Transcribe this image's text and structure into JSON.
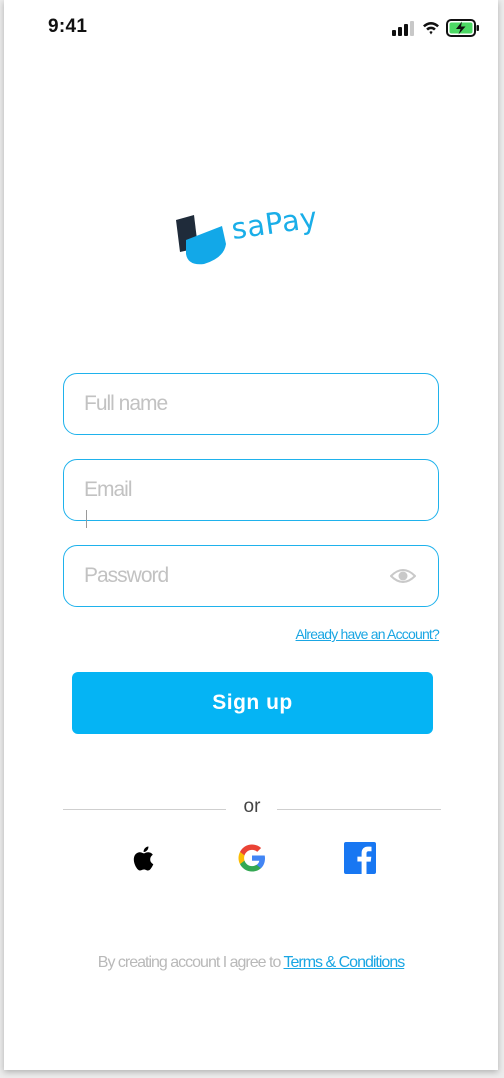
{
  "status_bar": {
    "time": "9:41",
    "signal_icon": "cellular-signal-icon",
    "wifi_icon": "wifi-icon",
    "battery_icon": "battery-charging-icon"
  },
  "brand": {
    "name": "saPay",
    "logo_icon": "sapay-logo-mark",
    "accent_color": "#05b4f4"
  },
  "form": {
    "full_name": {
      "placeholder": "Full name",
      "value": ""
    },
    "email": {
      "placeholder": "Email",
      "value": ""
    },
    "password": {
      "placeholder": "Password",
      "value": "",
      "toggle_icon": "eye-icon"
    }
  },
  "links": {
    "already_account": "Already have an Account?"
  },
  "actions": {
    "signup_label": "Sign up"
  },
  "divider": {
    "label": "or"
  },
  "social": [
    {
      "name": "Apple",
      "icon": "apple-icon"
    },
    {
      "name": "Google",
      "icon": "google-icon"
    },
    {
      "name": "Facebook",
      "icon": "facebook-icon"
    }
  ],
  "footer": {
    "terms_prefix": "By creating account I agree to ",
    "terms_link": "Terms & Conditions"
  }
}
